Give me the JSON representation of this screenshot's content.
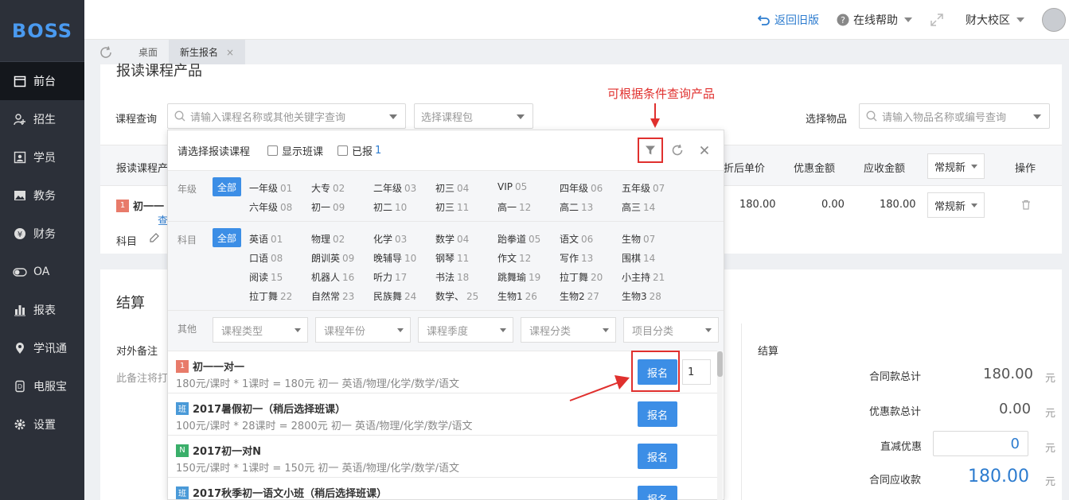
{
  "app": {
    "logo": "BOSS"
  },
  "sidebar": {
    "items": [
      {
        "label": "前台",
        "icon": "calendar-icon",
        "active": true
      },
      {
        "label": "招生",
        "icon": "user-add-icon"
      },
      {
        "label": "学员",
        "icon": "id-card-icon"
      },
      {
        "label": "教务",
        "icon": "image-icon"
      },
      {
        "label": "财务",
        "icon": "yen-icon"
      },
      {
        "label": "OA",
        "icon": "toggle-icon"
      },
      {
        "label": "报表",
        "icon": "bar-chart-icon"
      },
      {
        "label": "学讯通",
        "icon": "location-icon"
      },
      {
        "label": "电服宝",
        "icon": "phone-service-icon"
      },
      {
        "label": "设置",
        "icon": "gear-icon"
      }
    ]
  },
  "topbar": {
    "back_old": "返回旧版",
    "help": "在线帮助",
    "campus": "财大校区"
  },
  "tabs": [
    {
      "label": "桌面"
    },
    {
      "label": "新生报名",
      "active": true,
      "close": "×"
    }
  ],
  "main": {
    "section_title": "报读课程产品",
    "course_query_label": "课程查询",
    "course_query_placeholder": "请输入课程名称或其他关键字查询",
    "package_placeholder": "选择课程包",
    "item_label": "选择物品",
    "item_placeholder": "请输入物品名称或编号查询",
    "table_headers": {
      "course": "报读课程产",
      "price_after": "折后单价",
      "discount": "优惠金额",
      "receivable": "应收金额",
      "type": "常规新",
      "action": "操作"
    },
    "row": {
      "badge": "1",
      "name": "初一一",
      "view": "查",
      "subject": "科目",
      "price_after": "180.00",
      "discount": "0.00",
      "receivable": "180.00",
      "type": "常规新"
    }
  },
  "settlement": {
    "title": "结算",
    "note_label": "对外备注",
    "note_text": "此备注将打",
    "right_title": "结算",
    "contract_total_label": "合同款总计",
    "contract_total": "180.00",
    "discount_total_label": "优惠款总计",
    "discount_total": "0.00",
    "direct_discount_label": "直减优惠",
    "direct_discount": "0",
    "contract_receivable_label": "合同应收款",
    "contract_receivable": "180.00",
    "unit": "元"
  },
  "picker": {
    "title": "请选择报读课程",
    "show_class": "显示班课",
    "enrolled": "已报",
    "enrolled_count": "1",
    "grade_label": "年级",
    "subject_label": "科目",
    "other_label": "其他",
    "all": "全部",
    "grades": [
      [
        "一年级",
        "01"
      ],
      [
        "大专",
        "02"
      ],
      [
        "二年级",
        "03"
      ],
      [
        "初三",
        "04"
      ],
      [
        "VIP",
        "05"
      ],
      [
        "四年级",
        "06"
      ],
      [
        "五年级",
        "07"
      ],
      [
        "六年级",
        "08"
      ],
      [
        "初一",
        "09"
      ],
      [
        "初二",
        "10"
      ],
      [
        "初三",
        "11"
      ],
      [
        "高一",
        "12"
      ],
      [
        "高二",
        "13"
      ],
      [
        "高三",
        "14"
      ]
    ],
    "subjects": [
      [
        "英语",
        "01"
      ],
      [
        "物理",
        "02"
      ],
      [
        "化学",
        "03"
      ],
      [
        "数学",
        "04"
      ],
      [
        "跆拳道",
        "05"
      ],
      [
        "语文",
        "06"
      ],
      [
        "生物",
        "07"
      ],
      [
        "口语",
        "08"
      ],
      [
        "朗训英",
        "09"
      ],
      [
        "晚辅导",
        "10"
      ],
      [
        "钢琴",
        "11"
      ],
      [
        "作文",
        "12"
      ],
      [
        "写作",
        "13"
      ],
      [
        "围棋",
        "14"
      ],
      [
        "阅读",
        "15"
      ],
      [
        "机器人",
        "16"
      ],
      [
        "听力",
        "17"
      ],
      [
        "书法",
        "18"
      ],
      [
        "跳舞瑜",
        "19"
      ],
      [
        "拉丁舞",
        "20"
      ],
      [
        "小主持",
        "21"
      ],
      [
        "拉丁舞",
        "22"
      ],
      [
        "自然常",
        "23"
      ],
      [
        "民族舞",
        "24"
      ],
      [
        "数学、",
        "25"
      ],
      [
        "生物1",
        "26"
      ],
      [
        "生物2",
        "27"
      ],
      [
        "生物3",
        "28"
      ]
    ],
    "other_selects": [
      "课程类型",
      "课程年份",
      "课程季度",
      "课程分类",
      "项目分类"
    ],
    "courses": [
      {
        "badge": "1",
        "badge_color": "#e87b6a",
        "name": "初一一对一",
        "meta": "180元/课时 * 1课时 = 180元    初一    英语/物理/化学/数学/语文",
        "button": "报名",
        "qty": "1"
      },
      {
        "badge": "班",
        "badge_color": "#4a9ad8",
        "name": "2017暑假初一（稍后选择班课）",
        "meta": "100元/课时 * 28课时 = 2800元    初一    英语/物理/化学/数学/语文",
        "button": "报名"
      },
      {
        "badge": "N",
        "badge_color": "#3aaf6a",
        "name": "2017初一对N",
        "meta": "150元/课时 * 1课时 = 150元    初一    英语/物理/化学/数学/语文",
        "button": "报名"
      },
      {
        "badge": "班",
        "badge_color": "#4a9ad8",
        "name": "2017秋季初一语文小班（稍后选择班课）",
        "meta": "",
        "button": "报名"
      }
    ]
  },
  "annotation": {
    "text": "可根据条件查询产品",
    "color": "#e0302e"
  }
}
